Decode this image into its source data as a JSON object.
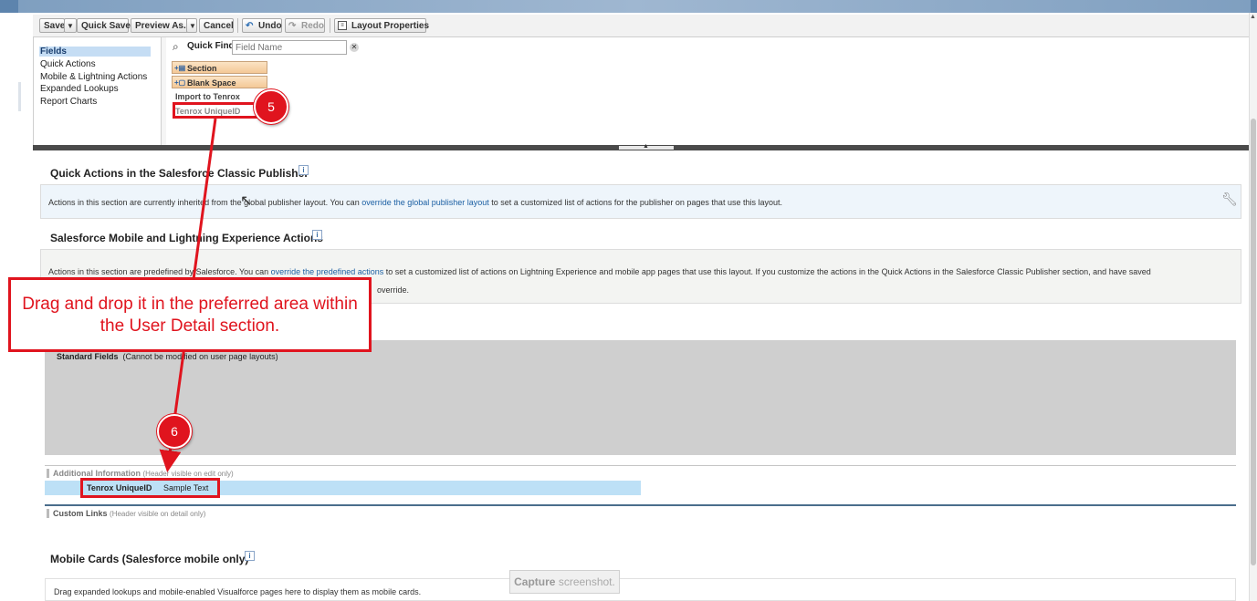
{
  "toolbar": {
    "save": "Save",
    "save_menu": "▼",
    "quick_save": "Quick Save",
    "preview_as": "Preview As...",
    "preview_menu": "▼",
    "cancel": "Cancel",
    "undo": "Undo",
    "redo": "Redo",
    "layout_properties": "Layout Properties"
  },
  "palette": {
    "categories": [
      "Fields",
      "Quick Actions",
      "Mobile & Lightning Actions",
      "Expanded Lookups",
      "Report Charts"
    ],
    "selected_category": "Fields",
    "quick_find_label": "Quick Find",
    "quick_find_placeholder": "Field Name",
    "items": [
      "Section",
      "Blank Space",
      "Import to Tenrox",
      "Tenrox UniqueID"
    ]
  },
  "sections": {
    "quick_actions_title": "Quick Actions in the Salesforce Classic Publisher",
    "quick_actions_msg_pre": "Actions in this section are currently inherited from the global publisher layout. You can ",
    "quick_actions_msg_link": "override the global publisher layout",
    "quick_actions_msg_post": " to set a customized list of actions for the publisher on pages that use this layout.",
    "sf_mobile_title": "Salesforce Mobile and Lightning Experience Actions",
    "sf_mobile_msg_pre": "Actions in this section are predefined by Salesforce. You can ",
    "sf_mobile_msg_link": "override the predefined actions",
    "sf_mobile_msg_post": " to set a customized list of actions on Lightning Experience and mobile app pages that use this layout. If you customize the actions in the Quick Actions in the Salesforce Classic Publisher section, and have saved",
    "sf_mobile_msg_line2": "override.",
    "standard_fields": "Standard Fields",
    "standard_fields_note": "(Cannot be modified on user page layouts)",
    "additional_info": "Additional Information",
    "additional_info_note": "(Header visible on edit only)",
    "field_name": "Tenrox UniqueID",
    "field_value": "Sample Text",
    "custom_links": "Custom Links",
    "custom_links_note": "(Header visible on detail only)",
    "mobile_cards_title": "Mobile Cards (Salesforce mobile only)",
    "mobile_cards_msg": "Drag expanded lookups and mobile-enabled Visualforce pages here to display them as mobile cards."
  },
  "annotations": {
    "step5": "5",
    "step6": "6",
    "callout": "Drag and drop it in the preferred area within the User Detail section.",
    "capture_bold": "Capture",
    "capture_rest": " screenshot."
  },
  "colors": {
    "annotation_red": "#e0141e",
    "field_highlight": "#bde0f6",
    "link": "#1b5fa3"
  }
}
